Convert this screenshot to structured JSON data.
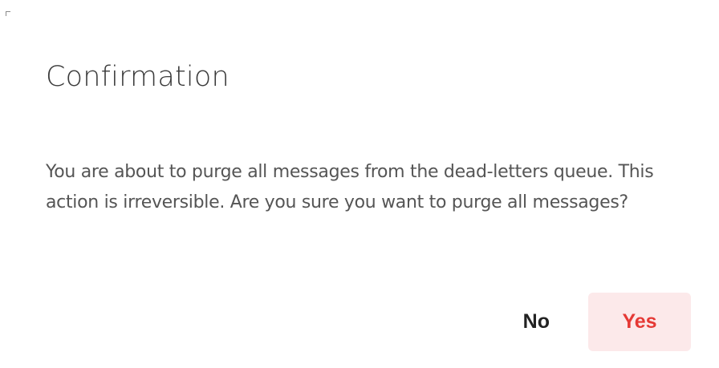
{
  "dialog": {
    "title": "Confirmation",
    "message": "You are about to purge all messages from the dead-letters queue. This action is irreversible. Are you sure you want to purge all messages?",
    "buttons": {
      "no_label": "No",
      "yes_label": "Yes"
    }
  },
  "colors": {
    "yes_text": "#e53935",
    "yes_background": "#fce9ea",
    "title_text": "#3b3b3b",
    "message_text": "#555555"
  }
}
